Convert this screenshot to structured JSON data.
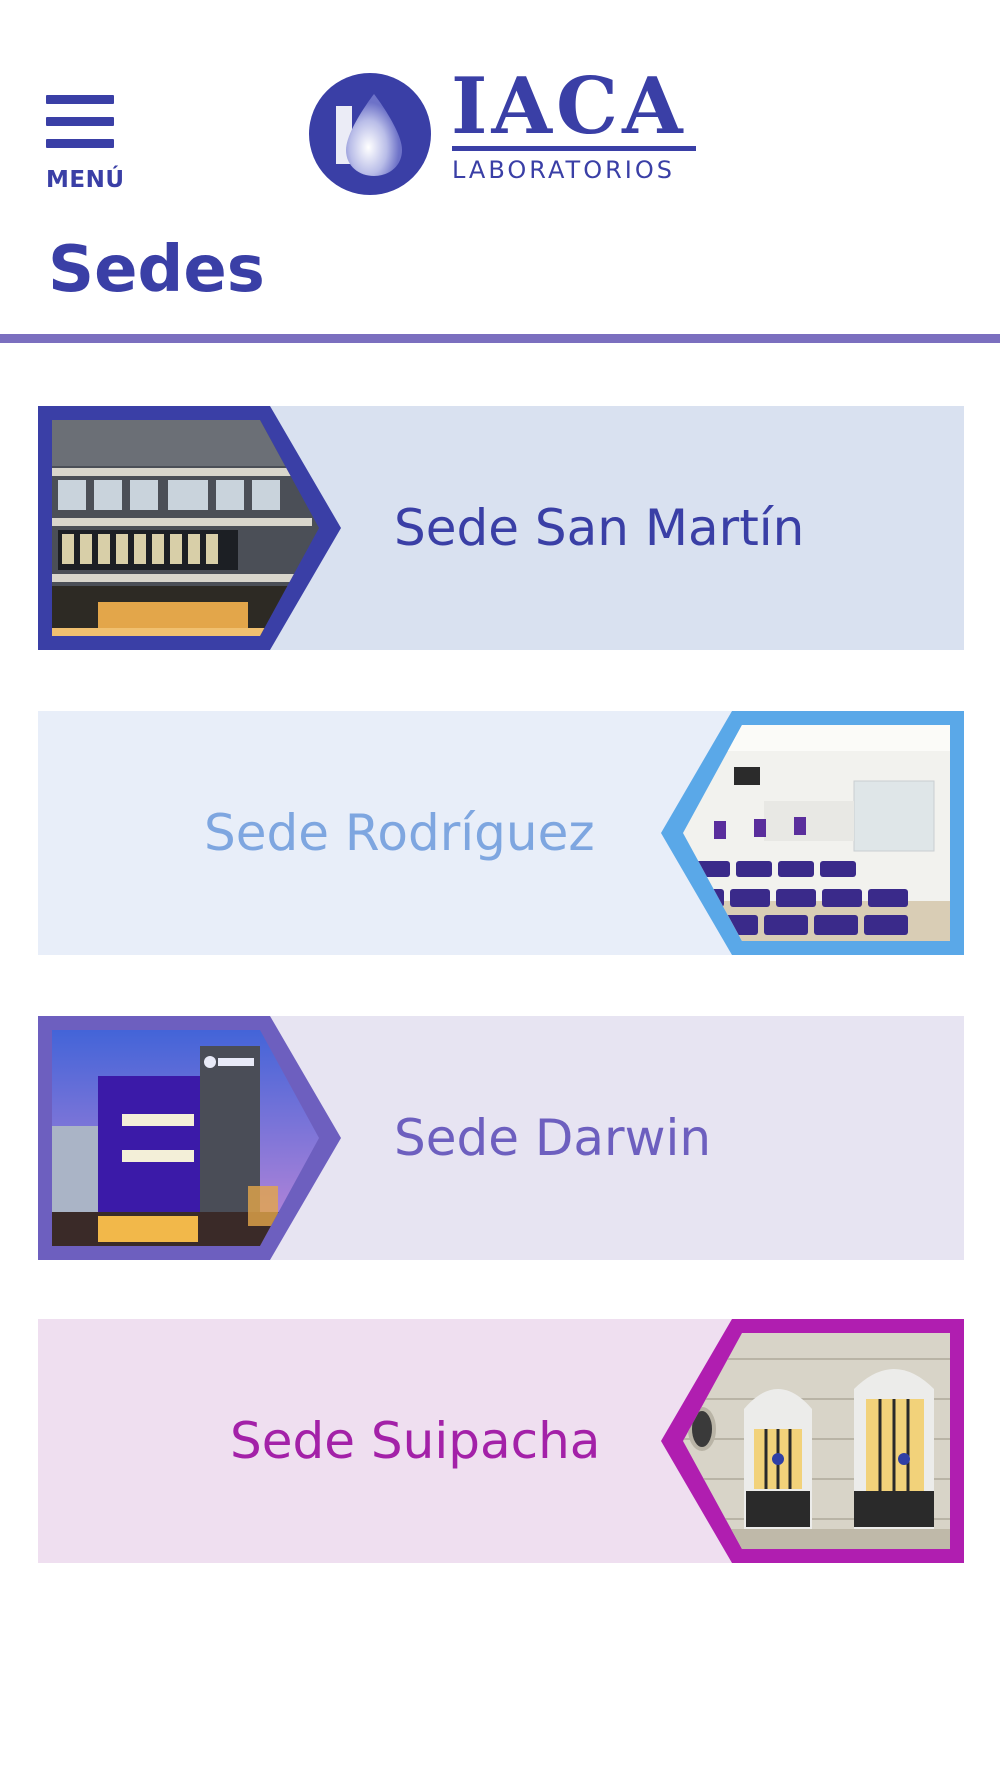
{
  "header": {
    "menu_label": "MENÚ",
    "logo_brand": "IACA",
    "logo_sub": "LABORATORIOS"
  },
  "page": {
    "title": "Sedes"
  },
  "sedes": [
    {
      "label": "Sede San Martín",
      "accent": "#3a3fa6",
      "bg": "#d9e1f0",
      "text_color": "#3a3fa6",
      "image_side": "left"
    },
    {
      "label": "Sede Rodríguez",
      "accent": "#5aa8e8",
      "bg": "#e8eef9",
      "text_color": "#7ea6e0",
      "image_side": "right"
    },
    {
      "label": "Sede Darwin",
      "accent": "#6d5fbf",
      "bg": "#e7e4f2",
      "text_color": "#6d5fbf",
      "image_side": "left"
    },
    {
      "label": "Sede Suipacha",
      "accent": "#b01eb0",
      "bg": "#efdff0",
      "text_color": "#a321a8",
      "image_side": "right"
    }
  ],
  "colors": {
    "brand": "#3a3fa6",
    "title_rule": "#7b6fbf"
  }
}
